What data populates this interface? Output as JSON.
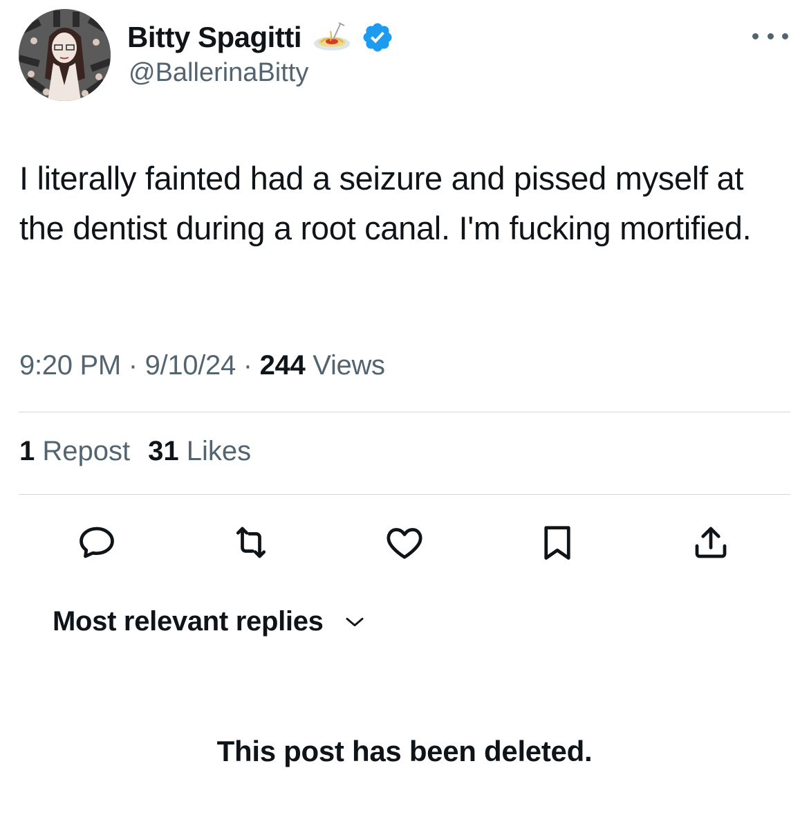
{
  "author": {
    "display_name": "Bitty Spagitti",
    "handle": "@BallerinaBitty",
    "name_emoji_icon": "spaghetti-icon",
    "verified": true,
    "verified_color": "#1d9bf0"
  },
  "tweet": {
    "text": "I literally fainted had a seizure and pissed myself at the dentist during a root canal. I'm fucking mortified.",
    "time": "9:20 PM",
    "separator": "·",
    "date": "9/10/24",
    "views_count": "244",
    "views_label": "Views"
  },
  "stats": {
    "reposts_count": "1",
    "reposts_label": "Repost",
    "likes_count": "31",
    "likes_label": "Likes"
  },
  "actions": [
    "reply-icon",
    "repost-icon",
    "like-icon",
    "bookmark-icon",
    "share-icon"
  ],
  "replies": {
    "sort_label": "Most relevant replies",
    "deleted_notice": "This post has been deleted."
  },
  "colors": {
    "text_primary": "#0f1419",
    "text_secondary": "#536471",
    "divider": "#cfd9de"
  }
}
